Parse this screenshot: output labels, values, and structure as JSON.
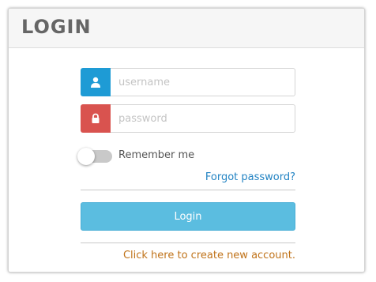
{
  "header": {
    "title": "LOGIN"
  },
  "form": {
    "username": {
      "icon": "user-icon",
      "icon_color": "#1e9bd5",
      "placeholder": "username",
      "value": ""
    },
    "password": {
      "icon": "lock-icon",
      "icon_color": "#d9534f",
      "placeholder": "password",
      "value": ""
    },
    "remember": {
      "label": "Remember me",
      "checked": false
    },
    "forgot_label": "Forgot password?",
    "submit_label": "Login",
    "create_account_label": "Click here to create new account."
  },
  "colors": {
    "link": "#2283c3",
    "create_link": "#c0731a",
    "button": "#5bbde0",
    "title": "#666666"
  }
}
